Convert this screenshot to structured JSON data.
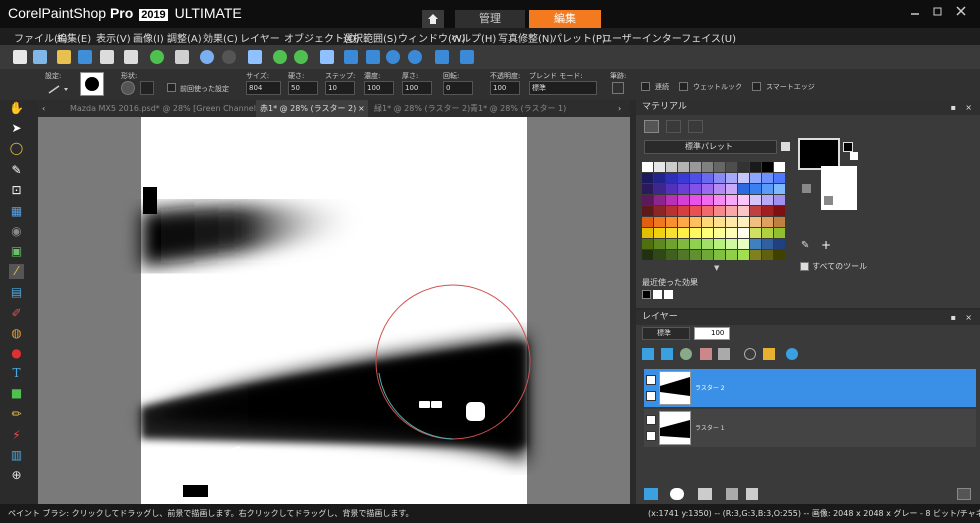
{
  "app": {
    "brand_corel": "Corel",
    "brand_paintshop": "PaintShop",
    "brand_pro": "Pro",
    "year": "2019",
    "edition": "ULTIMATE",
    "home_tab_icon": "home-icon",
    "tab_manage": "管理",
    "tab_edit": "編集",
    "accent": "#f47a20"
  },
  "menu": [
    "ファイル(F)",
    "編集(E)",
    "表示(V)",
    "画像(I)",
    "調整(A)",
    "効果(C)",
    "レイヤー",
    "オブジェクト(O)",
    "選択範囲(S)",
    "ウィンドウ(W)",
    "ヘルプ(H)",
    "写真修整(N)",
    "パレット(P)",
    "ユーザーインターフェイス(U)"
  ],
  "options": {
    "preset_label": "設定:",
    "shape_label": "形状:",
    "size_label": "サイズ:",
    "size_value": "804",
    "hardness_label": "硬さ:",
    "hardness_value": "50",
    "step_label": "ステップ:",
    "step_value": "10",
    "density_label": "濃度:",
    "density_value": "100",
    "thickness_label": "厚さ:",
    "thickness_value": "100",
    "rotation_label": "回転:",
    "rotation_value": "0",
    "opacity_label": "不透明度:",
    "opacity_value": "100",
    "blend_label": "ブレンド モード:",
    "blend_value": "標準",
    "stroke_label": "筆跡:",
    "use_last_label": "前回使った設定",
    "continuous_label": "連続",
    "wet_look_label": "ウェットルック",
    "smart_edge_label": "スマートエッジ"
  },
  "doc_tabs": [
    "Mazda MX5 2016.psd* @ 28% [Green Channel...",
    "赤1* @ 28% (ラスター 2)",
    "緑1* @ 28% (ラスター 2)",
    "青1* @ 28% (ラスター 1)"
  ],
  "doc_tab_close": "×",
  "materials": {
    "title": "マテリアル",
    "palette_select": "標準パレット",
    "recent_effects": "最近使った効果",
    "all_tools": "すべてのツール"
  },
  "layers": {
    "title": "レイヤー",
    "blend_mode": "標準",
    "opacity": "100",
    "items": [
      "ラスター 2",
      "ラスター 1"
    ]
  },
  "status": {
    "hint": "ペイント ブラシ: クリックしてドラッグし、前景で描画します。右クリックしてドラッグし、背景で描画します。",
    "info": "(x:1741 y:1350) -- (R:3,G:3,B:3,O:255) -- 画像: 2048 x 2048 x グレー - 8 ビット/チャネル"
  }
}
